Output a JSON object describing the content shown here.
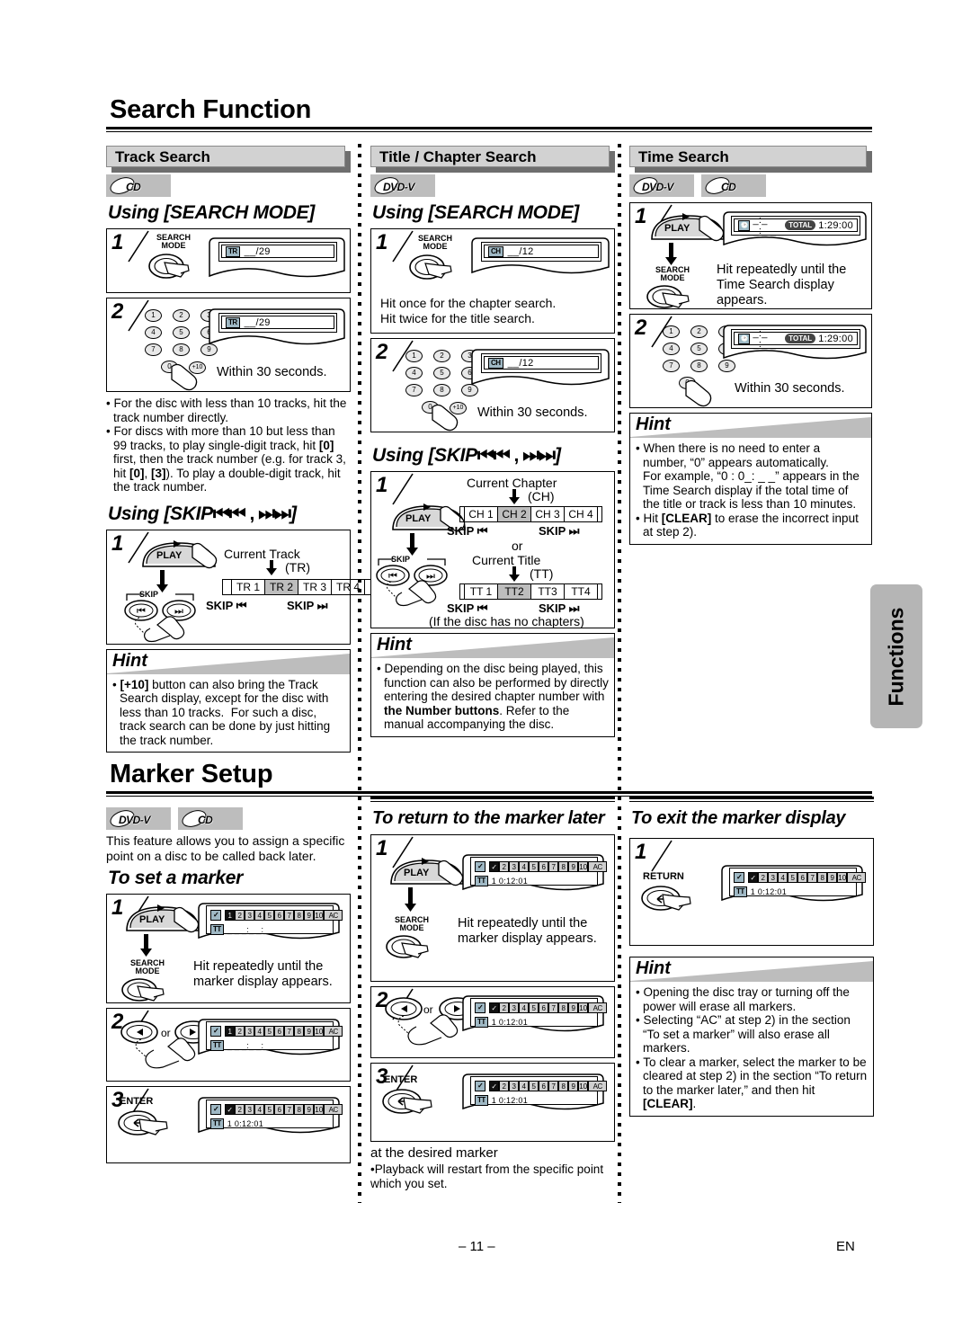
{
  "page": {
    "number": "– 11 –",
    "lang_code": "EN",
    "side_tab": "Functions"
  },
  "sections": [
    {
      "id": "search-function",
      "title": "Search Function"
    },
    {
      "id": "marker-setup",
      "title": "Marker Setup"
    }
  ],
  "track_search": {
    "band": "Track Search",
    "logos": [
      "CD"
    ],
    "heading_search_mode": "Using [SEARCH MODE]",
    "step1": {
      "num": "1",
      "button": "SEARCH\nMODE",
      "button_line1": "SEARCH",
      "button_line2": "MODE",
      "display_tag": "TR",
      "display_value": "__/29"
    },
    "step2": {
      "num": "2",
      "keys": [
        "1",
        "2",
        "3",
        "4",
        "5",
        "6",
        "7",
        "8",
        "9",
        "0",
        "+10"
      ],
      "display_tag": "TR",
      "display_value": "__/29",
      "caption": "Within 30 seconds."
    },
    "bullets": [
      "For the disc with less than 10 tracks, hit the track number directly.",
      "For discs with more than 10 but less than 99 tracks, to play single-digit track, hit [0] first, then the track number (e.g. for track 3, hit [0], [3]). To play a double-digit track, hit the track number."
    ],
    "heading_skip": "Using [SKIP",
    "heading_skip_tail": "]",
    "skip_step": {
      "num": "1",
      "play_label": "PLAY",
      "skip_label": "SKIP",
      "caption_top": "Current Track",
      "caption_tag": "(TR)",
      "cells": [
        "TR 1",
        "TR 2",
        "TR 3",
        "TR 4"
      ],
      "highlight_index": 1,
      "left_label": "SKIP",
      "right_label": "SKIP"
    },
    "hint": {
      "title": "Hint",
      "items": [
        "[+10] button can also bring the Track Search display, except for the disc with less than 10 tracks.  For such a disc, track search can be done by just hitting the track number."
      ]
    }
  },
  "title_chapter_search": {
    "band": "Title / Chapter Search",
    "logos": [
      "DVD-V"
    ],
    "heading_search_mode": "Using [SEARCH MODE]",
    "step1": {
      "num": "1",
      "button_line1": "SEARCH",
      "button_line2": "MODE",
      "display_tag": "CH",
      "display_value": "__/12",
      "caption_line1": "Hit once for the chapter search.",
      "caption_line2": "Hit twice for the title search."
    },
    "step2": {
      "num": "2",
      "keys": [
        "1",
        "2",
        "3",
        "4",
        "5",
        "6",
        "7",
        "8",
        "9",
        "0",
        "+10"
      ],
      "display_tag": "CH",
      "display_value": "__/12",
      "caption": "Within 30 seconds."
    },
    "heading_skip": "Using [SKIP",
    "heading_skip_tail": "]",
    "skip_step": {
      "num": "1",
      "play_label": "PLAY",
      "skip_label": "SKIP",
      "chapter_caption": "Current Chapter",
      "chapter_tag": "(CH)",
      "chapter_cells": [
        "CH 1",
        "CH 2",
        "CH 3",
        "CH 4"
      ],
      "chapter_highlight_index": 1,
      "or_label": "or",
      "title_caption": "Current Title",
      "title_tag": "(TT)",
      "title_cells": [
        "TT 1",
        "TT2",
        "TT3",
        "TT4"
      ],
      "title_highlight_index": 1,
      "left_label": "SKIP",
      "right_label": "SKIP",
      "footnote": "(If the disc has no chapters)"
    },
    "hint": {
      "title": "Hint",
      "items": [
        "Depending on the disc being played, this function can also be performed by directly entering the desired chapter number with the Number buttons. Refer to the manual accompanying the disc."
      ]
    }
  },
  "time_search": {
    "band": "Time Search",
    "logos": [
      "DVD-V",
      "CD"
    ],
    "step1": {
      "num": "1",
      "play_label": "PLAY",
      "button_line1": "SEARCH",
      "button_line2": "MODE",
      "display_time": "_:_ _:_ _",
      "display_total": "TOTAL",
      "display_value": "1:29:00",
      "caption": "Hit repeatedly until the Time Search display appears."
    },
    "step2": {
      "num": "2",
      "keys": [
        "1",
        "2",
        "3",
        "4",
        "5",
        "6",
        "7",
        "8",
        "9",
        "0"
      ],
      "display_time": "_:_ _:_ _",
      "display_total": "TOTAL",
      "display_value": "1:29:00",
      "caption": "Within 30 seconds."
    },
    "hint": {
      "title": "Hint",
      "items": [
        "When there is no need to enter a number, “0” appears automatically. For example, “0 : 0_: _ _” appears in the Time Search display if the total time of the title or track is less than 10 minutes.",
        "Hit [CLEAR] to erase the incorrect input at step 2)."
      ]
    }
  },
  "marker_set": {
    "logos": [
      "DVD-V",
      "CD"
    ],
    "intro": "This feature allows you to assign a specific point on a disc to be called back later.",
    "heading": "To set a marker",
    "step1": {
      "num": "1",
      "play_label": "PLAY",
      "button_line1": "SEARCH",
      "button_line2": "MODE",
      "marker_cells": [
        "1",
        "2",
        "3",
        "4",
        "5",
        "6",
        "7",
        "8",
        "9",
        "10",
        "AC"
      ],
      "selected_index": 0,
      "checked": [],
      "row2_tag": "TT",
      "row2_value": "_ _ _:_ _:_ _",
      "caption": "Hit repeatedly until the marker display appears."
    },
    "step2": {
      "num": "2",
      "or_label": "or",
      "marker_cells": [
        "1",
        "2",
        "3",
        "4",
        "5",
        "6",
        "7",
        "8",
        "9",
        "10",
        "AC"
      ],
      "selected_index": 0,
      "row2_tag": "TT",
      "row2_value": "_ _ _:_ _:_ _"
    },
    "step3": {
      "num": "3",
      "button": "ENTER",
      "marker_cells": [
        "✓",
        "2",
        "3",
        "4",
        "5",
        "6",
        "7",
        "8",
        "9",
        "10",
        "AC"
      ],
      "selected_index": 0,
      "row2_tag": "TT",
      "row2_value": "1  0:12:01"
    }
  },
  "marker_return": {
    "heading": "To return to the marker later",
    "step1": {
      "num": "1",
      "play_label": "PLAY",
      "button_line1": "SEARCH",
      "button_line2": "MODE",
      "marker_cells": [
        "✓",
        "2",
        "3",
        "4",
        "5",
        "6",
        "7",
        "8",
        "9",
        "10",
        "AC"
      ],
      "selected_index": 0,
      "row2_tag": "TT",
      "row2_value": "1  0:12:01",
      "caption": "Hit repeatedly until the marker display appears."
    },
    "step2": {
      "num": "2",
      "or_label": "or",
      "marker_cells": [
        "✓",
        "2",
        "3",
        "4",
        "5",
        "6",
        "7",
        "8",
        "9",
        "10",
        "AC"
      ],
      "selected_index": 0,
      "row2_tag": "TT",
      "row2_value": "1  0:12:01"
    },
    "step3": {
      "num": "3",
      "button": "ENTER",
      "marker_cells": [
        "✓",
        "2",
        "3",
        "4",
        "5",
        "6",
        "7",
        "8",
        "9",
        "10",
        "AC"
      ],
      "selected_index": 0,
      "row2_tag": "TT",
      "row2_value": "1  0:12:01"
    },
    "after_caption": "at the desired marker",
    "after_note": "•Playback will restart from the specific point which you set."
  },
  "marker_exit": {
    "heading": "To exit the marker display",
    "step1": {
      "num": "1",
      "button": "RETURN",
      "marker_cells": [
        "✓",
        "2",
        "3",
        "4",
        "5",
        "6",
        "7",
        "8",
        "9",
        "10",
        "AC"
      ],
      "selected_index": 0,
      "row2_tag": "TT",
      "row2_value": "1  0:12:01"
    },
    "hint": {
      "title": "Hint",
      "items": [
        "Opening the disc tray or turning off the power will erase all markers.",
        "Selecting “AC” at step 2) in the section “To set a marker” will also erase all markers.",
        "To clear a marker, select the marker to be cleared at step 2) in the section “To return to the marker later,” and then hit [CLEAR]."
      ]
    }
  },
  "colors": {
    "band_fill": "#d2d2d2",
    "band_shadow": "#6e6e6e",
    "logo_fill": "#bdbdbd",
    "highlight": "#bdbdbd",
    "tag_fill": "#9fb8c4",
    "tab_fill": "#b5b5b5"
  }
}
